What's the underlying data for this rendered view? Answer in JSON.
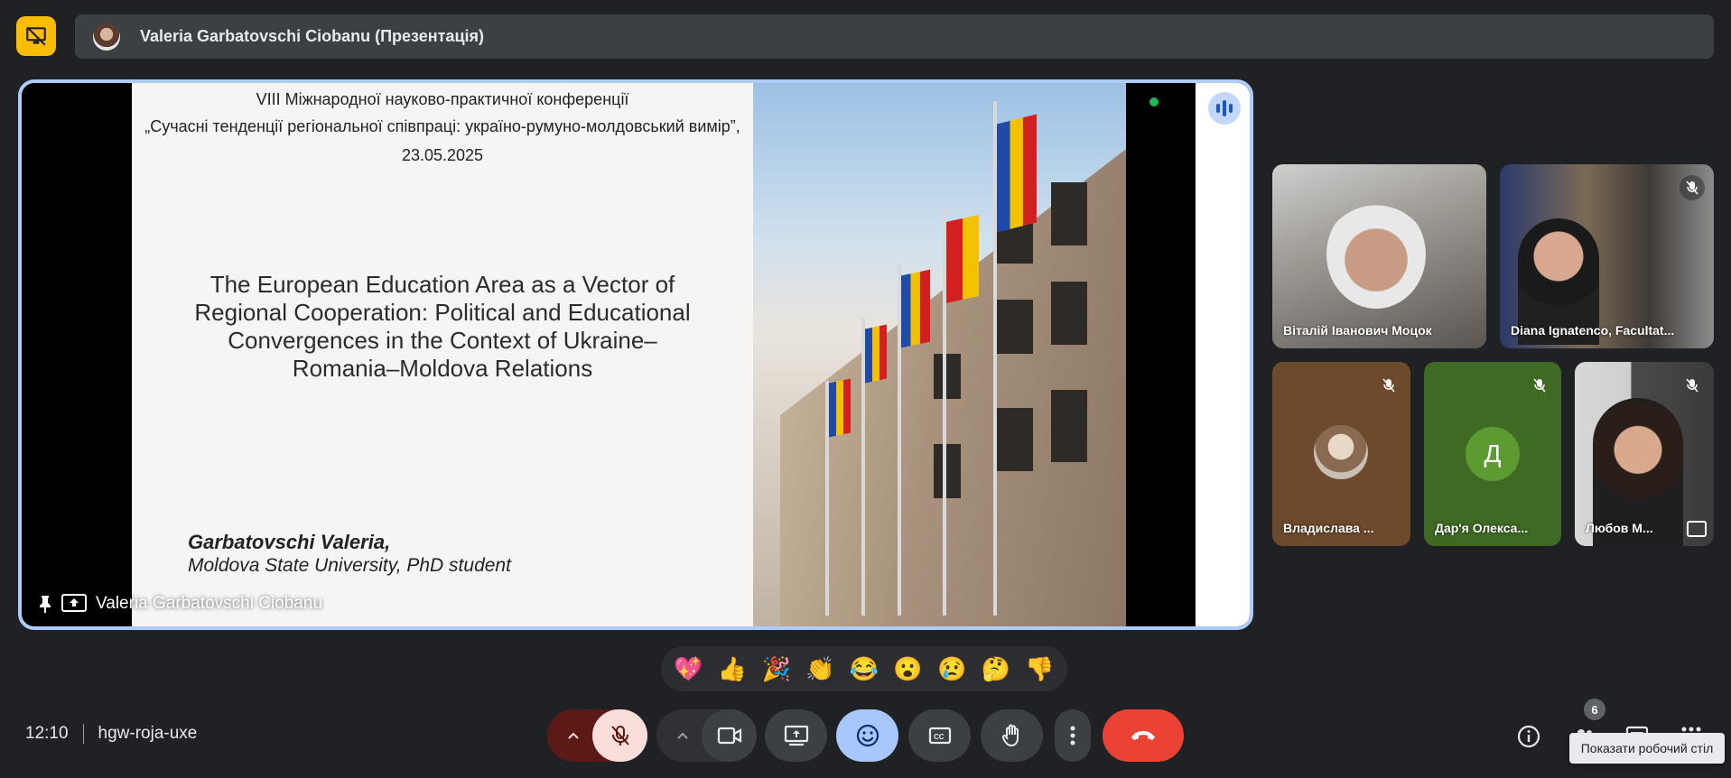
{
  "topbar": {
    "presenter_title": "Valeria Garbatovschi Ciobanu (Презентація)"
  },
  "slide": {
    "conference_line1": "VIII Міжнародної науково-практичної конференції",
    "conference_line2": "„Сучасні тенденції регіональної співпраці:  україно-румуно-молдовський вимір”,",
    "conference_date": "23.05.2025",
    "title_line1": "The European Education Area as a Vector of",
    "title_line2": "Regional Cooperation: Political and Educational",
    "title_line3": "Convergences in the Context of Ukraine–",
    "title_line4": "Romania–Moldova Relations",
    "author_name": "Garbatovschi Valeria,",
    "author_affiliation": "Moldova State University, PhD student"
  },
  "main_tile": {
    "presenter_name": "Valeria Garbatovschi Ciobanu"
  },
  "participants": [
    {
      "name": "Віталій Іванович Моцок",
      "muted": false
    },
    {
      "name": "Diana Ignatenco, Facultat...",
      "muted": true
    },
    {
      "name": "Владислава ...",
      "muted": true
    },
    {
      "name": "Дар'я Олекса...",
      "muted": true,
      "initial": "Д"
    },
    {
      "name": "Любов М...",
      "muted": true
    }
  ],
  "reactions": [
    "💖",
    "👍",
    "🎉",
    "👏",
    "😂",
    "😮",
    "😢",
    "🤔",
    "👎"
  ],
  "footer": {
    "time": "12:10",
    "meeting_code": "hgw-roja-uxe",
    "participant_count": "6",
    "tooltip": "Показати робочий стіл"
  },
  "colors": {
    "accent_blue": "#aecbfa",
    "end_call_red": "#ea4335",
    "presenting_yellow": "#fbbc04",
    "mic_off_pink": "#f9dedc"
  }
}
